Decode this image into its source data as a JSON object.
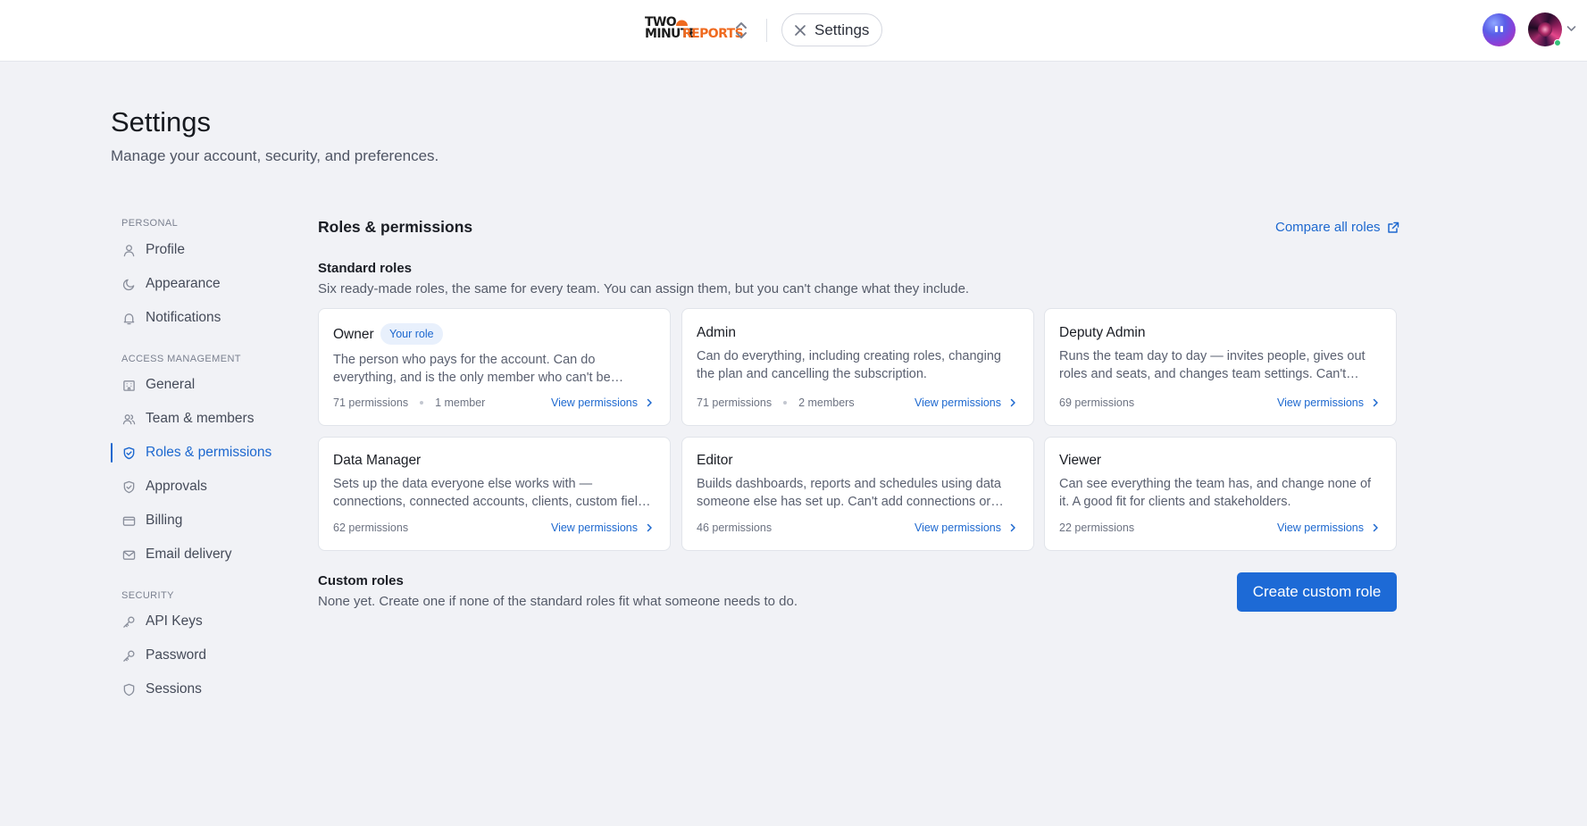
{
  "topbar": {
    "logo_line1": "TWO",
    "logo_line2a": "MINUTE",
    "logo_line2b": "REPORTS",
    "context_pill_label": "Settings",
    "icons": {
      "switcher": "chevron-up-down-icon",
      "close": "close-icon",
      "caret": "chevron-down-icon"
    }
  },
  "page": {
    "title": "Settings",
    "subtitle": "Manage your account, security, and preferences."
  },
  "sidebar": {
    "sections": [
      {
        "label": "PERSONAL",
        "items": [
          {
            "label": "Profile",
            "icon": "user-icon"
          },
          {
            "label": "Appearance",
            "icon": "moon-icon"
          },
          {
            "label": "Notifications",
            "icon": "bell-icon"
          }
        ]
      },
      {
        "label": "ACCESS MANAGEMENT",
        "items": [
          {
            "label": "General",
            "icon": "building-icon"
          },
          {
            "label": "Team & members",
            "icon": "users-icon"
          },
          {
            "label": "Roles & permissions",
            "icon": "shield-check-icon",
            "active": true
          },
          {
            "label": "Approvals",
            "icon": "shield-check-icon"
          },
          {
            "label": "Billing",
            "icon": "credit-card-icon"
          },
          {
            "label": "Email delivery",
            "icon": "mail-icon"
          }
        ]
      },
      {
        "label": "SECURITY",
        "items": [
          {
            "label": "API Keys",
            "icon": "key-icon"
          },
          {
            "label": "Password",
            "icon": "key-icon"
          },
          {
            "label": "Sessions",
            "icon": "shield-icon"
          }
        ]
      }
    ]
  },
  "main": {
    "title": "Roles & permissions",
    "compare_link": "Compare all roles",
    "standard": {
      "title": "Standard roles",
      "subtitle": "Six ready-made roles, the same for every team. You can assign them, but you can't change what they include."
    },
    "roles": [
      {
        "name": "Owner",
        "badge": "Your role",
        "description": "The person who pays for the account. Can do everything, and is the only member who can't be removed or have their role changed.",
        "permissions": "71 permissions",
        "members": "1 member",
        "view": "View permissions"
      },
      {
        "name": "Admin",
        "description": "Can do everything, including creating roles, changing the plan and cancelling the subscription.",
        "permissions": "71 permissions",
        "members": "2 members",
        "view": "View permissions"
      },
      {
        "name": "Deputy Admin",
        "description": "Runs the team day to day — invites people, gives out roles and seats, and changes team settings. Can't change billing or the plan.",
        "permissions": "69 permissions",
        "view": "View permissions"
      },
      {
        "name": "Data Manager",
        "description": "Sets up the data everyone else works with — connections, connected accounts, clients, custom fields and metrics.",
        "permissions": "62 permissions",
        "view": "View permissions"
      },
      {
        "name": "Editor",
        "description": "Builds dashboards, reports and schedules using data someone else has set up. Can't add connections or change team settings.",
        "permissions": "46 permissions",
        "view": "View permissions"
      },
      {
        "name": "Viewer",
        "description": "Can see everything the team has, and change none of it. A good fit for clients and stakeholders.",
        "permissions": "22 permissions",
        "view": "View permissions"
      }
    ],
    "custom": {
      "title": "Custom roles",
      "subtitle": "None yet. Create one if none of the standard roles fit what someone needs to do.",
      "button": "Create custom role"
    }
  },
  "colors": {
    "accent": "#1d68cf",
    "button": "#1d6ad6",
    "logo_orange": "#ef6a1f",
    "page_bg": "#f1f2f6"
  }
}
